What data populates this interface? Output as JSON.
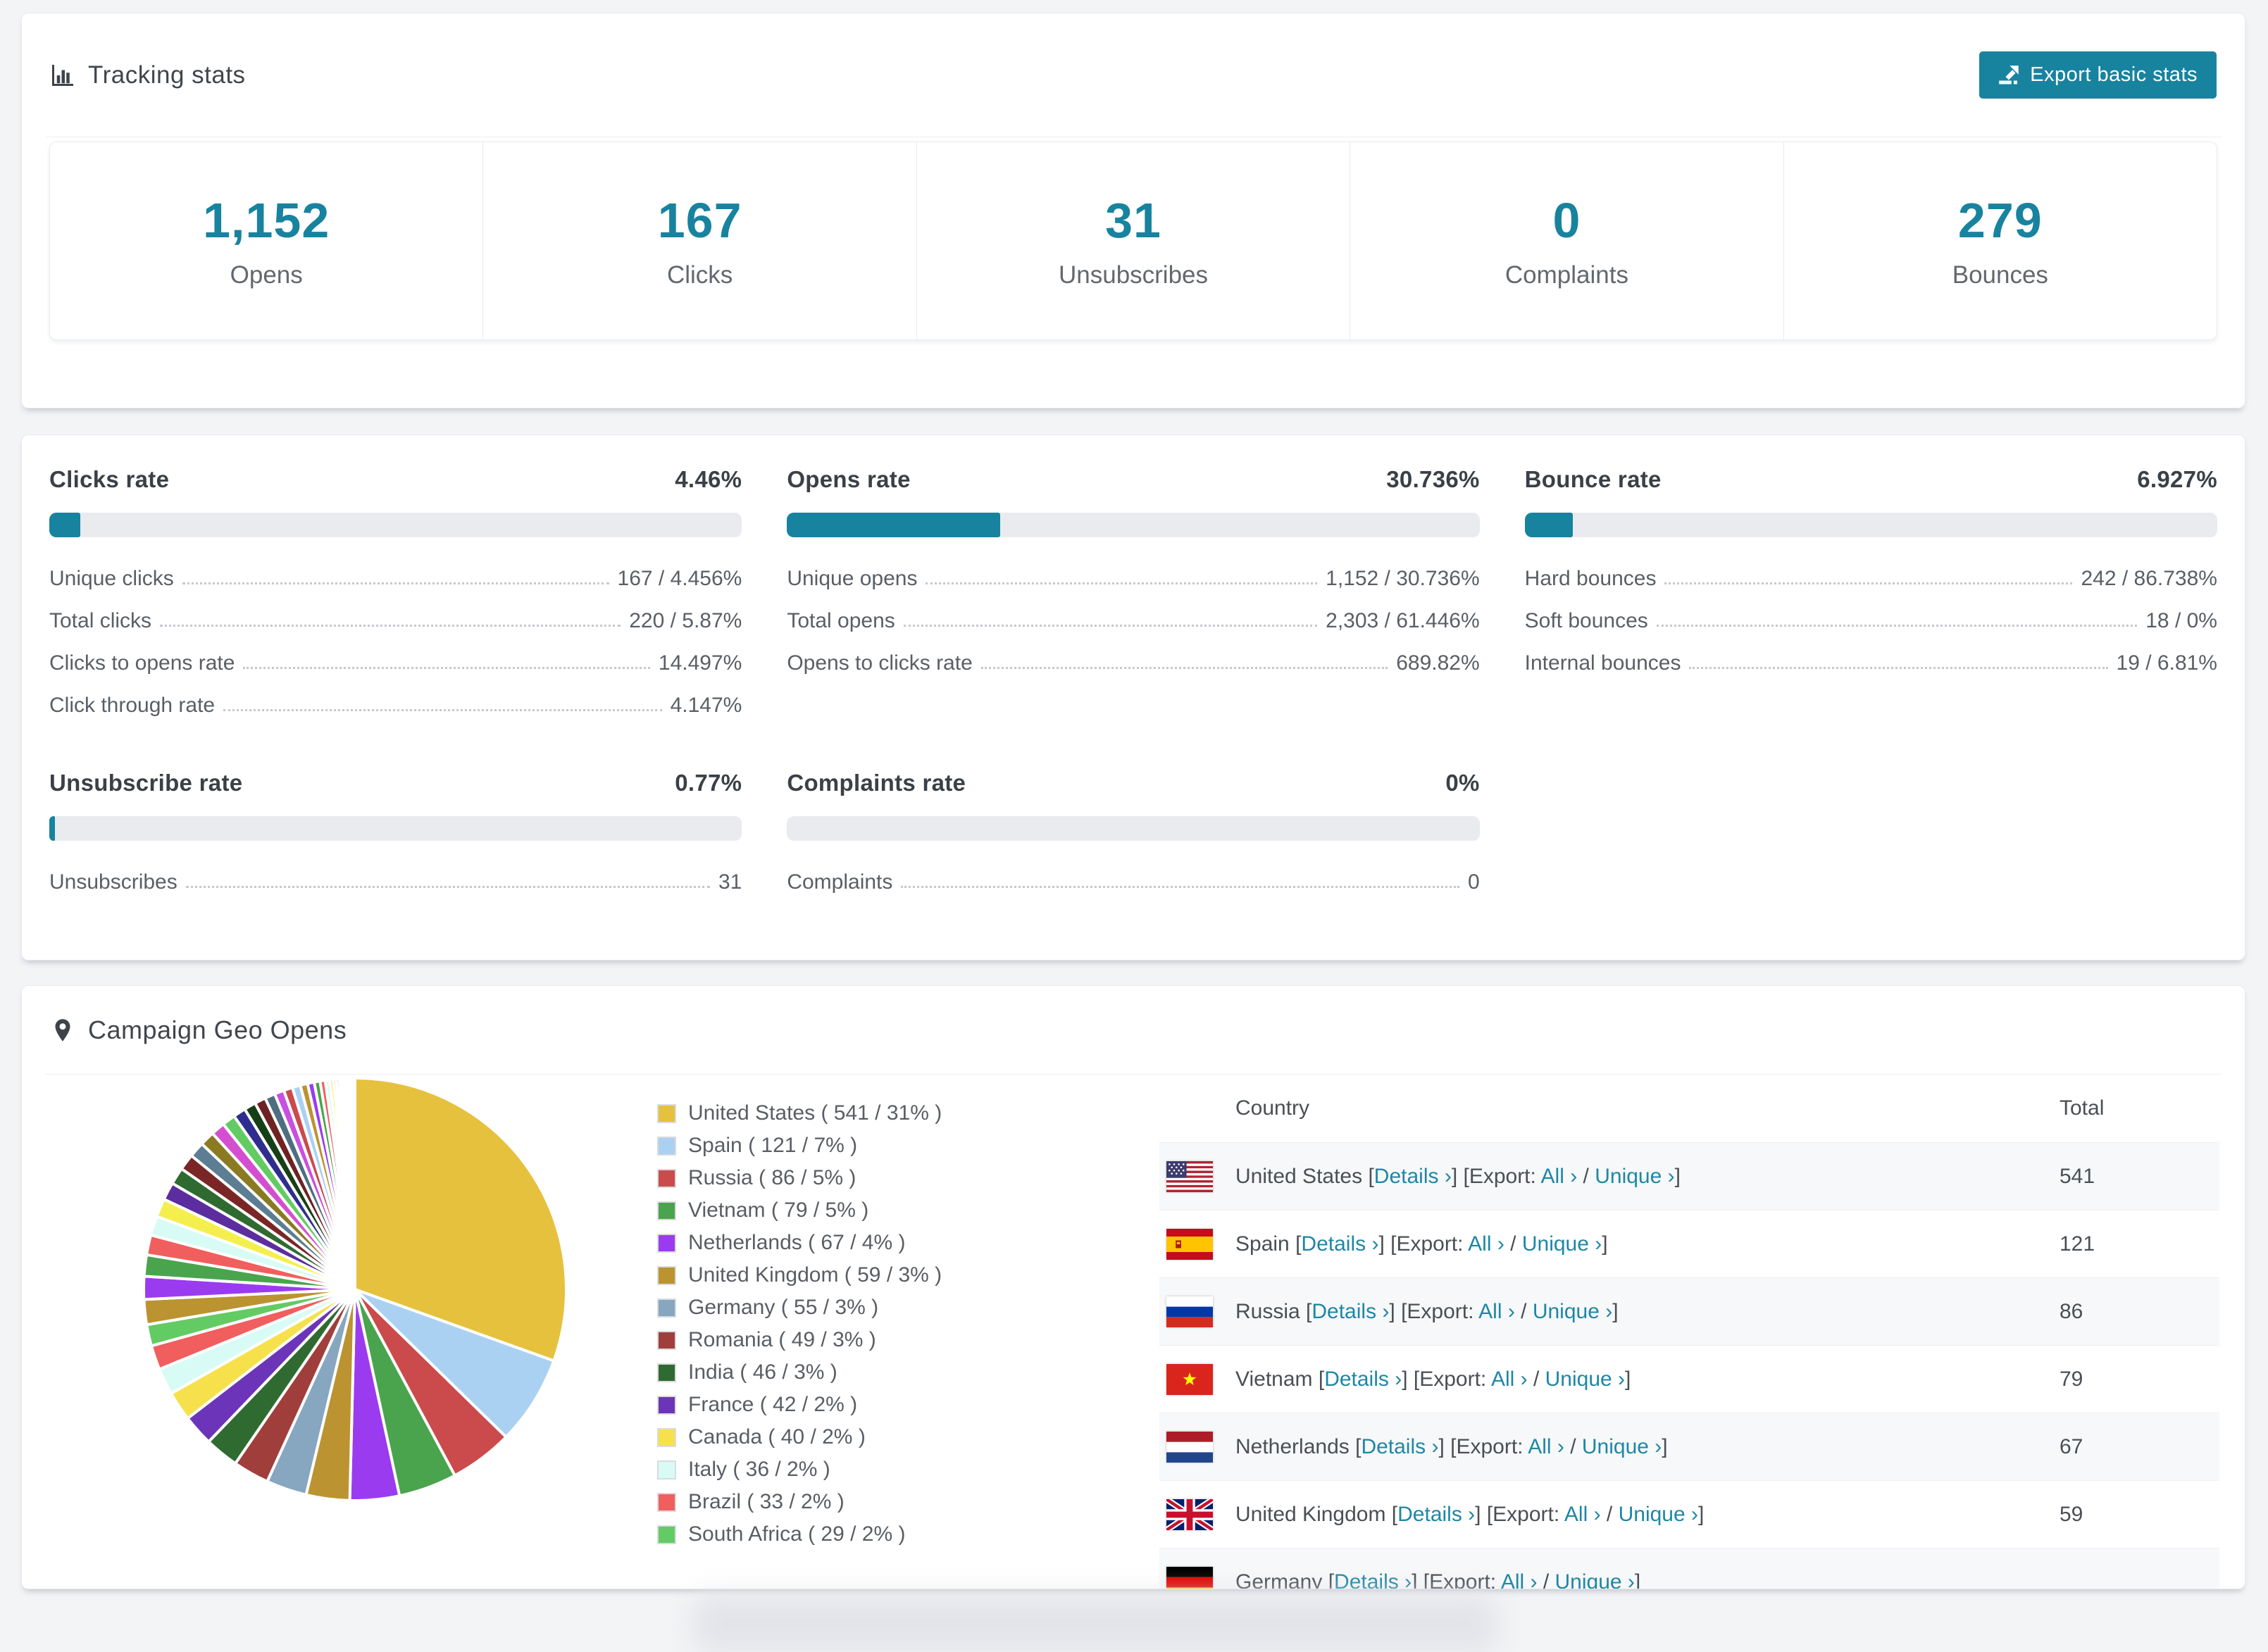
{
  "colors": {
    "accent": "#18839e",
    "link": "#1e87a5",
    "bar_track": "#e9ebef",
    "page_bg": "#f3f4f6"
  },
  "tracking_card": {
    "icon": "bar-chart-icon",
    "title": "Tracking stats",
    "export_button": {
      "icon": "export-icon",
      "label": "Export basic stats"
    },
    "stats": [
      {
        "value": "1,152",
        "label": "Opens"
      },
      {
        "value": "167",
        "label": "Clicks"
      },
      {
        "value": "31",
        "label": "Unsubscribes"
      },
      {
        "value": "0",
        "label": "Complaints"
      },
      {
        "value": "279",
        "label": "Bounces"
      }
    ]
  },
  "rates": {
    "panels": [
      {
        "title": "Clicks rate",
        "value": "4.46%",
        "bar_pct": 4.46,
        "rows": [
          {
            "label": "Unique clicks",
            "value": "167 / 4.456%"
          },
          {
            "label": "Total clicks",
            "value": "220 / 5.87%"
          },
          {
            "label": "Clicks to opens rate",
            "value": "14.497%"
          },
          {
            "label": "Click through rate",
            "value": "4.147%"
          }
        ]
      },
      {
        "title": "Opens rate",
        "value": "30.736%",
        "bar_pct": 30.736,
        "rows": [
          {
            "label": "Unique opens",
            "value": "1,152 / 30.736%"
          },
          {
            "label": "Total opens",
            "value": "2,303 / 61.446%"
          },
          {
            "label": "Opens to clicks rate",
            "value": "689.82%"
          }
        ]
      },
      {
        "title": "Bounce rate",
        "value": "6.927%",
        "bar_pct": 6.927,
        "rows": [
          {
            "label": "Hard bounces",
            "value": "242 / 86.738%"
          },
          {
            "label": "Soft bounces",
            "value": "18 / 0%"
          },
          {
            "label": "Internal bounces",
            "value": "19 / 6.81%"
          }
        ]
      },
      {
        "title": "Unsubscribe rate",
        "value": "0.77%",
        "bar_pct": 0.77,
        "rows": [
          {
            "label": "Unsubscribes",
            "value": "31"
          }
        ]
      },
      {
        "title": "Complaints rate",
        "value": "0%",
        "bar_pct": 0,
        "rows": [
          {
            "label": "Complaints",
            "value": "0"
          }
        ]
      }
    ]
  },
  "geo": {
    "icon": "map-marker-icon",
    "title": "Campaign Geo Opens",
    "legend": [
      {
        "label": "United States ( 541 / 31% )",
        "color": "#e6c13e"
      },
      {
        "label": "Spain ( 121 / 7% )",
        "color": "#abd1f2"
      },
      {
        "label": "Russia ( 86 / 5% )",
        "color": "#cb4a4c"
      },
      {
        "label": "Vietnam ( 79 / 5% )",
        "color": "#4aa44d"
      },
      {
        "label": "Netherlands ( 67 / 4% )",
        "color": "#9b3bf0"
      },
      {
        "label": "United Kingdom ( 59 / 3% )",
        "color": "#bb9330"
      },
      {
        "label": "Germany ( 55 / 3% )",
        "color": "#87a6bf"
      },
      {
        "label": "Romania ( 49 / 3% )",
        "color": "#a03e3c"
      },
      {
        "label": "India ( 46 / 3% )",
        "color": "#2f6b31"
      },
      {
        "label": "France ( 42 / 2% )",
        "color": "#6c35b9"
      },
      {
        "label": "Canada ( 40 / 2% )",
        "color": "#f6e14d"
      },
      {
        "label": "Italy ( 36 / 2% )",
        "color": "#d8fbf5"
      },
      {
        "label": "Brazil ( 33 / 2% )",
        "color": "#f15e5e"
      },
      {
        "label": "South Africa ( 29 / 2% )",
        "color": "#63cb63"
      }
    ],
    "table": {
      "columns": [
        "Country",
        "Total"
      ],
      "details_label": "Details ›",
      "export_prefix": "[Export:",
      "all_label": "All ›",
      "unique_label": "Unique ›",
      "rows": [
        {
          "country": "United States",
          "flag": "us",
          "total": "541"
        },
        {
          "country": "Spain",
          "flag": "es",
          "total": "121"
        },
        {
          "country": "Russia",
          "flag": "ru",
          "total": "86"
        },
        {
          "country": "Vietnam",
          "flag": "vn",
          "total": "79"
        },
        {
          "country": "Netherlands",
          "flag": "nl",
          "total": "67"
        },
        {
          "country": "United Kingdom",
          "flag": "gb",
          "total": "59"
        },
        {
          "country": "Germany",
          "flag": "de",
          "total": ""
        }
      ]
    }
  },
  "chart_data": {
    "type": "pie",
    "title": "Campaign Geo Opens",
    "legend_position": "right",
    "start_angle_deg": 0,
    "direction": "clockwise",
    "labels": [
      "United States",
      "Spain",
      "Russia",
      "Vietnam",
      "Netherlands",
      "United Kingdom",
      "Germany",
      "Romania",
      "India",
      "France",
      "Canada",
      "Italy",
      "Brazil",
      "South Africa"
    ],
    "values": [
      541,
      121,
      86,
      79,
      67,
      59,
      55,
      49,
      46,
      42,
      40,
      36,
      33,
      29
    ],
    "percents": [
      31,
      7,
      5,
      5,
      4,
      3,
      3,
      3,
      3,
      2,
      2,
      2,
      2,
      2
    ],
    "colors": [
      "#e6c13e",
      "#abd1f2",
      "#cb4a4c",
      "#4aa44d",
      "#9b3bf0",
      "#bb9330",
      "#87a6bf",
      "#a03e3c",
      "#2f6b31",
      "#6c35b9",
      "#f6e14d",
      "#d8fbf5",
      "#f15e5e",
      "#63cb63"
    ],
    "others_unlabeled_estimated": [
      34,
      31,
      29,
      27,
      26,
      25,
      24,
      23,
      22,
      21,
      20,
      19,
      18,
      17,
      16,
      15,
      14,
      13,
      12,
      11,
      10,
      9,
      8,
      7,
      6,
      5,
      4,
      4,
      3,
      3,
      2,
      2,
      2,
      1,
      1,
      1,
      1,
      1,
      1,
      1,
      1,
      1
    ],
    "others_palette": [
      "#bb9330",
      "#9b3bf0",
      "#4aa44d",
      "#f15e5e",
      "#d8fbf5",
      "#f4ef4e",
      "#5b2d9e",
      "#2f6b31",
      "#7a2626",
      "#5c7d92",
      "#8a7a22",
      "#d44fd0",
      "#63cb63",
      "#2f2d8f",
      "#173f17",
      "#6e2222",
      "#4f6f80",
      "#c94fe0",
      "#cb4a4c",
      "#abd1f2"
    ]
  }
}
